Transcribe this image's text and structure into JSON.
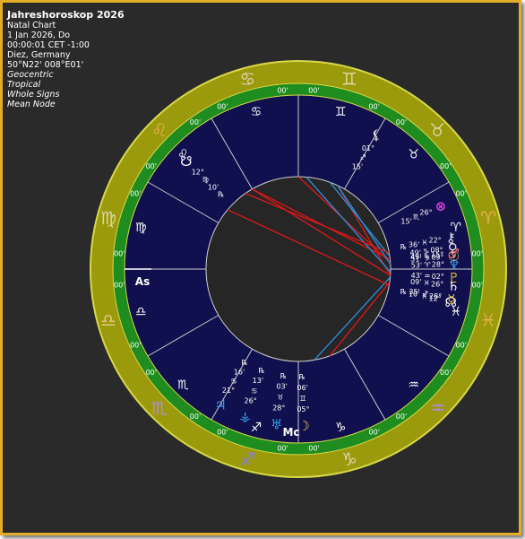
{
  "chart_info": {
    "title": "Jahreshoroskop 2026",
    "chart_type": "Natal Chart",
    "date": "1 Jan 2026, Do",
    "time": "00:00:01  CET -1:00",
    "place": "Diez, Germany",
    "coordinates": "50°N22' 008°E01'",
    "system": "Geocentric",
    "zodiac": "Tropical",
    "houses": "Whole Signs",
    "node": "Mean Node"
  },
  "colors": {
    "background": "#2a2a2a",
    "frame": "#e3ad2a",
    "outer_ring": "#9a9a0c",
    "house_ring": "#1e8c1e",
    "wheel": "#10104e",
    "center": "#262626",
    "aspect_hard": "#e01818",
    "aspect_soft": "#2f8fe0"
  },
  "zodiac_signs": [
    {
      "name": "Aries",
      "glyph": "♈",
      "color": "#e4b04a"
    },
    {
      "name": "Taurus",
      "glyph": "♉",
      "color": "#dcd4a0"
    },
    {
      "name": "Gemini",
      "glyph": "♊",
      "color": "#dcd4a0"
    },
    {
      "name": "Cancer",
      "glyph": "♋",
      "color": "#e2d2b6"
    },
    {
      "name": "Leo",
      "glyph": "♌",
      "color": "#e4b04a"
    },
    {
      "name": "Virgo",
      "glyph": "♍",
      "color": "#dcd4a0"
    },
    {
      "name": "Libra",
      "glyph": "♎",
      "color": "#e5c880"
    },
    {
      "name": "Scorpio",
      "glyph": "♏",
      "color": "#b48ae0"
    },
    {
      "name": "Sagittarius",
      "glyph": "♐",
      "color": "#8a7ae0"
    },
    {
      "name": "Capricorn",
      "glyph": "♑",
      "color": "#e2d2b6"
    },
    {
      "name": "Aquarius",
      "glyph": "♒",
      "color": "#b48ae0"
    },
    {
      "name": "Pisces",
      "glyph": "♓",
      "color": "#e4b04a"
    }
  ],
  "house_cusp_labels": [
    "00'",
    "00'",
    "00'",
    "00'",
    "00'",
    "00'",
    "00'",
    "00'",
    "00'",
    "00'",
    "00'",
    "00'",
    "00'",
    "00'",
    "00'",
    "00'",
    "00'",
    "00'",
    "00'",
    "00'",
    "00'",
    "00'",
    "00'",
    "00'"
  ],
  "axes": {
    "asc": "As",
    "mc": "Mc"
  },
  "planets": [
    {
      "name": "Neptune",
      "glyph": "♆",
      "color": "#3a9ae8",
      "deg": "28°",
      "sign": "♈",
      "min": "53'",
      "retro": ""
    },
    {
      "name": "Saturn",
      "glyph": "♄",
      "color": "#ffffff",
      "deg": "26°",
      "sign": "♓",
      "min": "09'",
      "retro": ""
    },
    {
      "name": "North Node",
      "glyph": "☊",
      "color": "#ffffff",
      "deg": "12°",
      "sign": "♓",
      "min": "10'",
      "retro": "℞"
    },
    {
      "name": "Pluto",
      "glyph": "♇",
      "color": "#e8c040",
      "deg": "02°",
      "sign": "♒",
      "min": "43'",
      "retro": ""
    },
    {
      "name": "Venus",
      "glyph": "♀",
      "color": "#e8e8e8",
      "deg": "08°",
      "sign": "♑",
      "min": "49'",
      "retro": ""
    },
    {
      "name": "Chiron",
      "glyph": "⚷",
      "color": "#e8e8e8",
      "deg": "22°",
      "sign": "♓",
      "min": "36'",
      "retro": "℞"
    },
    {
      "name": "Sun",
      "glyph": "☉",
      "color": "#e8c040",
      "deg": "09°",
      "sign": "♑",
      "min": "51'",
      "retro": ""
    },
    {
      "name": "Mars",
      "glyph": "♂",
      "color": "#f06a6a",
      "deg": "15°",
      "sign": "♑",
      "min": "49'",
      "retro": ""
    },
    {
      "name": "Mercury",
      "glyph": "☿",
      "color": "#e8c040",
      "deg": "28°",
      "sign": "♐",
      "min": "35'",
      "retro": ""
    },
    {
      "name": "Lilith",
      "glyph": "⚸",
      "color": "#e8e8e8",
      "deg": "01°",
      "sign": "♐",
      "min": "15'",
      "retro": ""
    },
    {
      "name": "Fortune",
      "glyph": "⊗",
      "color": "#e040e0",
      "deg": "26°",
      "sign": "♏",
      "min": "15'",
      "retro": ""
    },
    {
      "name": "South Node",
      "glyph": "☋",
      "color": "#ffffff",
      "deg": "12°",
      "sign": "♍",
      "min": "10'",
      "retro": "℞"
    },
    {
      "name": "Jupiter",
      "glyph": "♃",
      "color": "#3a9ae8",
      "deg": "21°",
      "sign": "♋",
      "min": "16'",
      "retro": "℞"
    },
    {
      "name": "Vesta",
      "glyph": "⚶",
      "color": "#3a9ae8",
      "deg": "26°",
      "sign": "♋",
      "min": "13'",
      "retro": "℞"
    },
    {
      "name": "Uranus",
      "glyph": "♅",
      "color": "#3a9ae8",
      "deg": "28°",
      "sign": "♉",
      "min": "03'",
      "retro": "℞"
    },
    {
      "name": "Moon",
      "glyph": "☽",
      "color": "#e8c040",
      "deg": "05°",
      "sign": "♊",
      "min": "06'",
      "retro": "℞"
    }
  ]
}
